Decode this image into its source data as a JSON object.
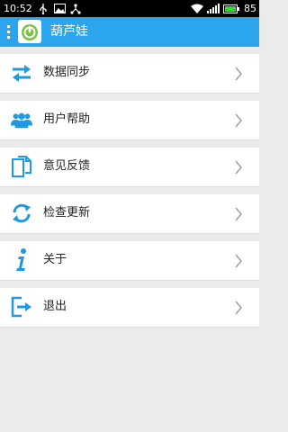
{
  "status_bar": {
    "time": "10:52",
    "battery_percent": "85",
    "icons": [
      "usb-icon",
      "image-icon",
      "share-icon",
      "wifi-icon",
      "signal-icon",
      "battery-icon"
    ]
  },
  "app_bar": {
    "title": "葫芦娃",
    "color": "#2aa5ee"
  },
  "menu": {
    "items": [
      {
        "label": "数据同步",
        "icon": "sync-arrows-icon"
      },
      {
        "label": "用户帮助",
        "icon": "users-icon"
      },
      {
        "label": "意见反馈",
        "icon": "feedback-icon"
      },
      {
        "label": "检查更新",
        "icon": "refresh-icon"
      },
      {
        "label": "关于",
        "icon": "info-icon"
      },
      {
        "label": "退出",
        "icon": "exit-icon"
      }
    ]
  },
  "colors": {
    "accent": "#2aa5ee",
    "icon_blue": "#1e9ae0",
    "background": "#ebebeb"
  }
}
